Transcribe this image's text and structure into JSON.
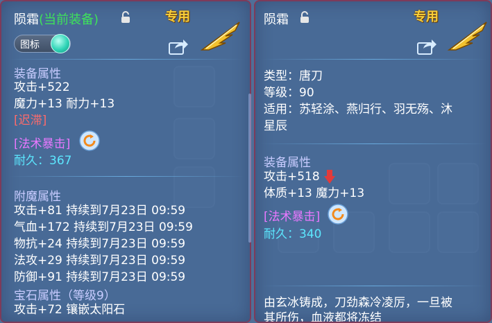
{
  "left": {
    "item_name": "陨霜",
    "equipped_tag": "(当前装备)",
    "exclusive_label": "专用",
    "toggle_label": "图标",
    "equip_section": "装备属性",
    "attack": "攻击+522",
    "magic_endurance": "魔力+13 耐力+13",
    "special_effect": "[迟滞]",
    "skill": "[法术暴击]",
    "durability": "耐久：367",
    "enchant_section": "附魔属性",
    "enchants": [
      "攻击+81 持续到7月23日 09:59",
      "气血+172 持续到7月23日 09:59",
      "物抗+24 持续到7月23日 09:59",
      "法攻+29 持续到7月23日 09:59",
      "防御+91 持续到7月23日 09:59"
    ],
    "gem_section": "宝石属性（等级9）",
    "gem_line": "攻击+72 镶嵌太阳石"
  },
  "right": {
    "item_name": "陨霜",
    "exclusive_label": "专用",
    "type": "类型：唐刀",
    "level": "等级：90",
    "usable_line1": "适用：苏轻涂、燕归行、羽无殇、沐",
    "usable_line2": "星辰",
    "equip_section": "装备属性",
    "attack": "攻击+518",
    "physique_magic": "体质+13 魔力+13",
    "skill": "[法术暴击]",
    "durability": "耐久：340",
    "description_line1": "由玄冰铸成，刀劲森冷凌厉，一旦被",
    "description_line2": "其所伤，血液都将冻结"
  },
  "colors": {
    "exclusive": "#f8cf3a",
    "equipped": "#3ee35a",
    "section": "#c8ccff",
    "effect_red": "#ff6b6b",
    "skill_purple": "#e978ff",
    "durability_cyan": "#5ce8ff",
    "decrease_arrow": "#e23b3b"
  },
  "icons": {
    "lock": "lock-icon",
    "share": "share-icon",
    "weapon": "weapon-wing-icon",
    "skill": "refresh-skill-icon",
    "down_arrow": "down-arrow-icon"
  }
}
